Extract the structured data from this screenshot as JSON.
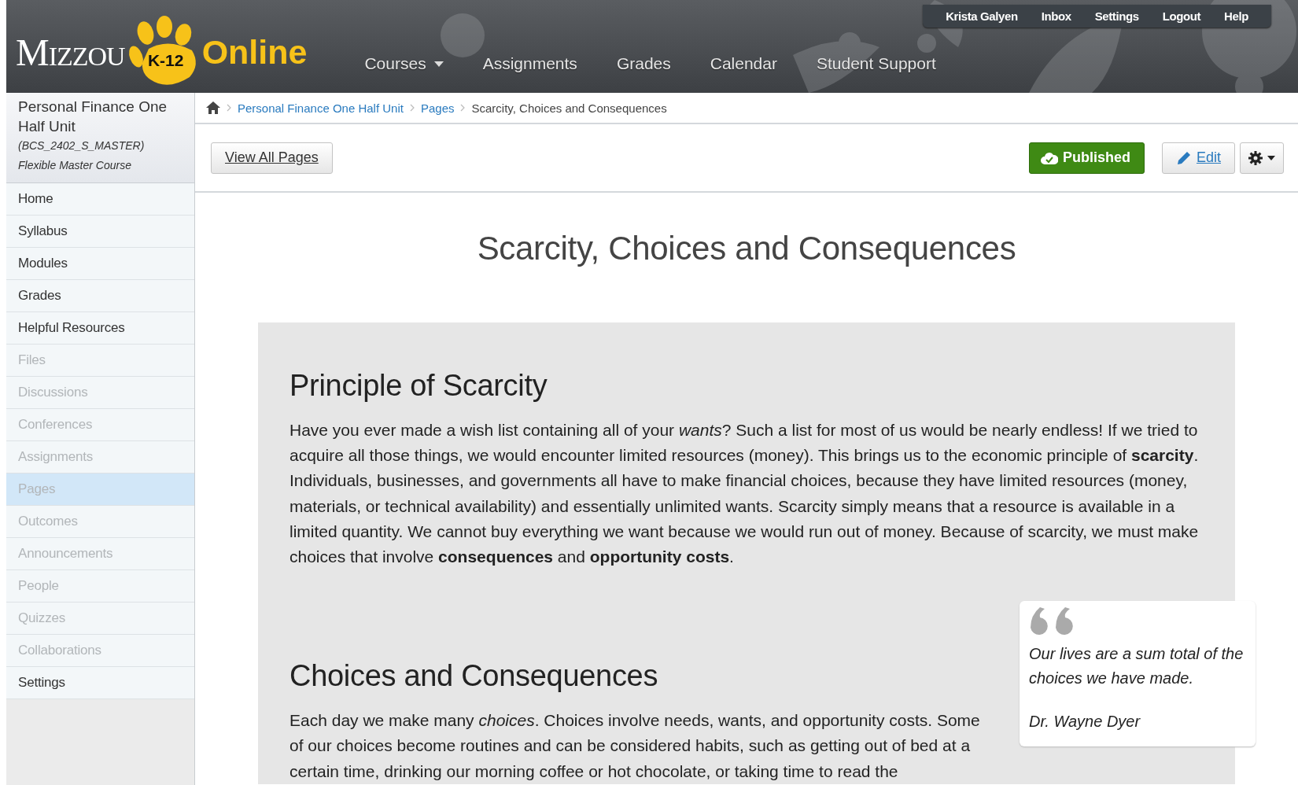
{
  "logo": {
    "wordmark": "Mizzou",
    "badge": "K-12",
    "suffix": "Online"
  },
  "nav": [
    {
      "label": "Courses",
      "dropdown": true
    },
    {
      "label": "Assignments",
      "dropdown": false
    },
    {
      "label": "Grades",
      "dropdown": false
    },
    {
      "label": "Calendar",
      "dropdown": false
    },
    {
      "label": "Student Support",
      "dropdown": false
    }
  ],
  "user_menu": [
    "Krista Galyen",
    "Inbox",
    "Settings",
    "Logout",
    "Help"
  ],
  "course": {
    "name": "Personal Finance One Half Unit",
    "code": "(BCS_2402_S_MASTER)",
    "subtitle": "Flexible Master Course"
  },
  "sidebar": {
    "items": [
      {
        "label": "Home",
        "disabled": false,
        "selected": false
      },
      {
        "label": "Syllabus",
        "disabled": false,
        "selected": false
      },
      {
        "label": "Modules",
        "disabled": false,
        "selected": false
      },
      {
        "label": "Grades",
        "disabled": false,
        "selected": false
      },
      {
        "label": "Helpful Resources",
        "disabled": false,
        "selected": false
      },
      {
        "label": "Files",
        "disabled": true,
        "selected": false
      },
      {
        "label": "Discussions",
        "disabled": true,
        "selected": false
      },
      {
        "label": "Conferences",
        "disabled": true,
        "selected": false
      },
      {
        "label": "Assignments",
        "disabled": true,
        "selected": false
      },
      {
        "label": "Pages",
        "disabled": true,
        "selected": true
      },
      {
        "label": "Outcomes",
        "disabled": true,
        "selected": false
      },
      {
        "label": "Announcements",
        "disabled": true,
        "selected": false
      },
      {
        "label": "People",
        "disabled": true,
        "selected": false
      },
      {
        "label": "Quizzes",
        "disabled": true,
        "selected": false
      },
      {
        "label": "Collaborations",
        "disabled": true,
        "selected": false
      },
      {
        "label": "Settings",
        "disabled": false,
        "selected": false
      }
    ]
  },
  "breadcrumbs": [
    {
      "label": "Personal Finance One Half Unit",
      "kind": "link"
    },
    {
      "label": "Pages",
      "kind": "link"
    },
    {
      "label": "Scarcity, Choices and Consequences",
      "kind": "current"
    }
  ],
  "toolbar": {
    "view_all": "View All Pages",
    "status": {
      "label": "Published",
      "published": true
    },
    "edit": "Edit"
  },
  "page": {
    "title": "Scarcity, Choices and Consequences",
    "sections": [
      {
        "heading": "Principle of Scarcity",
        "text": "Have you ever made a wish list containing all of your *wants*? Such a list for most of us would be nearly endless! If we tried to acquire all those things, we would encounter limited resources (money). This brings us to the economic principle of **scarcity**. Individuals, businesses, and governments all have to make financial choices, because they have limited resources (money, materials, or technical availability) and essentially unlimited wants. Scarcity simply means that a resource is available in a limited quantity. We cannot buy everything we want because we would run out of money. Because of scarcity, we must make choices that involve **consequences** and **opportunity costs**."
      },
      {
        "heading": "Choices and Consequences",
        "text": "Each day we make many *choices*. Choices involve needs, wants, and opportunity costs. Some of our choices become routines and can be considered habits, such as getting out of bed at a certain time, drinking our morning coffee or hot chocolate, or taking time to read the"
      }
    ],
    "quote": {
      "text": "Our lives are a sum total of the choices we have made.",
      "author": "Dr. Wayne Dyer"
    }
  }
}
